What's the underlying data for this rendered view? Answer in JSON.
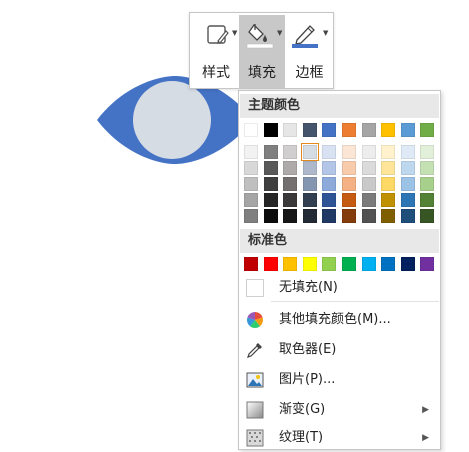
{
  "toolbar": {
    "style_label": "样式",
    "fill_label": "填充",
    "border_label": "边框",
    "fill_current_color": "#ffffff",
    "border_current_color": "#4472c4"
  },
  "shape": {
    "fill_color": "#4472c4",
    "pupil_color": "#d6dce4",
    "icon": "eye-shape"
  },
  "menu": {
    "theme_colors_title": "主题颜色",
    "standard_colors_title": "标准色",
    "theme_base": [
      "#ffffff",
      "#000000",
      "#e7e6e6",
      "#44546a",
      "#4472c4",
      "#ed7d31",
      "#a5a5a5",
      "#ffc000",
      "#5b9bd5",
      "#70ad47"
    ],
    "theme_shades": [
      [
        "#f2f2f2",
        "#7f7f7f",
        "#d0cece",
        "#d6dce4",
        "#d9e2f3",
        "#fbe5d5",
        "#ededed",
        "#fff2cc",
        "#deebf6",
        "#e2efd9"
      ],
      [
        "#d8d8d8",
        "#595959",
        "#aeaaaa",
        "#adb9ca",
        "#b4c6e7",
        "#f7cbac",
        "#dbdbdb",
        "#fee599",
        "#bdd7ee",
        "#c5e0b3"
      ],
      [
        "#bfbfbf",
        "#3f3f3f",
        "#757070",
        "#8496b0",
        "#8eaadb",
        "#f4b183",
        "#c9c9c9",
        "#ffd966",
        "#9cc3e5",
        "#a8d08d"
      ],
      [
        "#a5a5a5",
        "#262626",
        "#3a3838",
        "#323f4f",
        "#2f5496",
        "#c55a11",
        "#7b7b7b",
        "#bf9000",
        "#2e75b5",
        "#538135"
      ],
      [
        "#7f7f7f",
        "#0c0c0c",
        "#171616",
        "#222a35",
        "#1f3864",
        "#833c0b",
        "#525252",
        "#7f6000",
        "#1e4e79",
        "#375623"
      ]
    ],
    "standard_colors": [
      "#c00000",
      "#ff0000",
      "#ffc000",
      "#ffff00",
      "#92d050",
      "#00b050",
      "#00b0f0",
      "#0070c0",
      "#002060",
      "#7030a0"
    ],
    "selected_swatch_color": "#d6dce4",
    "items": {
      "no_fill": "无填充(N)",
      "more_colors": "其他填充颜色(M)...",
      "eyedropper": "取色器(E)",
      "picture": "图片(P)...",
      "gradient": "渐变(G)",
      "texture": "纹理(T)"
    },
    "submenu_arrow": "▶"
  }
}
